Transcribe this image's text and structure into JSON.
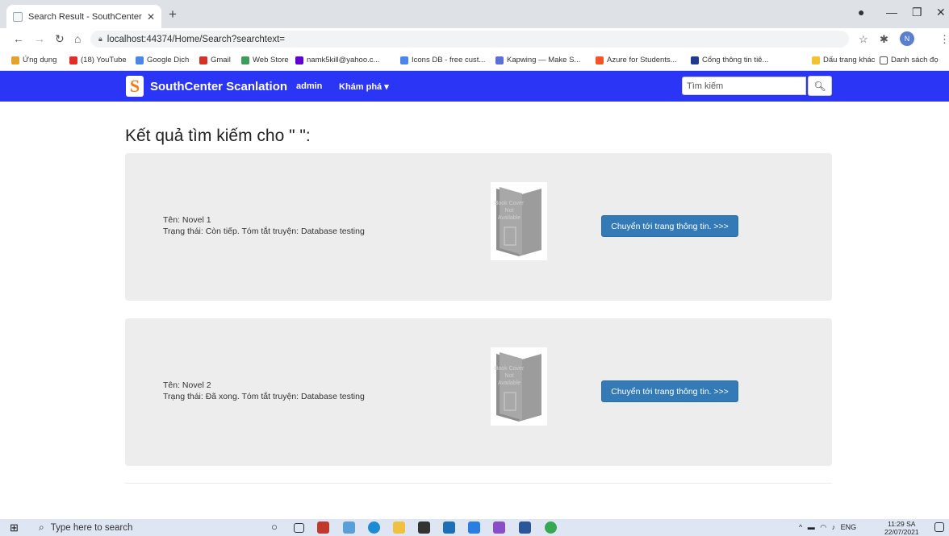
{
  "browser": {
    "tab_title": "Search Result - SouthCenter Scan",
    "new_tab": "+",
    "url": "localhost:44374/Home/Search?searchtext=",
    "profile_initial": "N"
  },
  "bookmarks": [
    {
      "label": "Ứng dụng",
      "icon": "apps-grid-icon",
      "color": "#e3a22a"
    },
    {
      "label": "(18) YouTube",
      "icon": "youtube-icon",
      "color": "#e52d27"
    },
    {
      "label": "Google Dịch",
      "icon": "translate-icon",
      "color": "#4a86e8"
    },
    {
      "label": "Gmail",
      "icon": "gmail-icon",
      "color": "#d93025"
    },
    {
      "label": "Web Store",
      "icon": "webstore-icon",
      "color": "#3a9d5d"
    },
    {
      "label": "namk5kill@yahoo.c...",
      "icon": "yahoo-mail-icon",
      "color": "#6001d2"
    },
    {
      "label": "Icons DB - free cust...",
      "icon": "heart-icon",
      "color": "#4a86e8"
    },
    {
      "label": "Kapwing — Make S...",
      "icon": "kapwing-icon",
      "color": "#5b6fd8"
    },
    {
      "label": "Azure for Students...",
      "icon": "microsoft-icon",
      "color": "#f35325"
    },
    {
      "label": "Cổng thông tin tiê...",
      "icon": "portal-icon",
      "color": "#203a90"
    },
    {
      "label": "Dấu trang khác",
      "icon": "folder-icon",
      "color": "#f2c230"
    },
    {
      "label": "Danh sách đọ",
      "icon": "reading-list-icon",
      "color": "#555555"
    }
  ],
  "site": {
    "logo_letter": "S",
    "brand": "SouthCenter Scanlation",
    "nav_admin": "admin",
    "nav_explore": "Khám phá ▾",
    "search_placeholder": "Tìm kiếm",
    "accent": "#2b35f5"
  },
  "main": {
    "heading": "Kết quả tìm kiếm cho \" \":",
    "results": [
      {
        "name_line": "Tên: Novel 1",
        "status_line": "Trạng thái: Còn tiếp. Tóm tắt truyện: Database testing",
        "cover_text": "Book Cover Not Available",
        "button": "Chuyển tới trang thông tin. >>>"
      },
      {
        "name_line": "Tên: Novel 2",
        "status_line": "Trạng thái: Đã xong. Tóm tắt truyện: Database testing",
        "cover_text": "Book Cover Not Available",
        "button": "Chuyển tới trang thông tin. >>>"
      }
    ]
  },
  "taskbar": {
    "search_placeholder": "Type here to search",
    "lang": "ENG",
    "time": "11:29 SA",
    "date": "22/07/2021"
  }
}
